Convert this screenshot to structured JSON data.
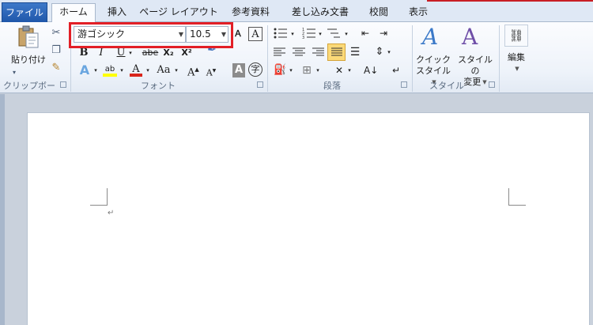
{
  "tabs": {
    "file": "ファイル",
    "home": "ホーム",
    "insert": "挿入",
    "page_layout": "ページ レイアウト",
    "references": "参考資料",
    "mailings": "差し込み文書",
    "review": "校閲",
    "view": "表示"
  },
  "clipboard": {
    "paste_label": "貼り付け",
    "group_label": "クリップボード"
  },
  "font": {
    "font_name": "游ゴシック",
    "font_size": "10.5",
    "group_label": "フォント",
    "bold": "B",
    "italic": "I",
    "underline": "U",
    "strike": "abe",
    "subscript": "X₂",
    "superscript": "X²",
    "grow": "A",
    "shrink": "A",
    "case": "Aa",
    "char_shade": "A",
    "enclose": "字",
    "text_effect": "A",
    "highlight": "ab",
    "font_color": "A"
  },
  "paragraph": {
    "group_label": "段落"
  },
  "styles": {
    "quick_style_line1": "クイック",
    "quick_style_line2": "スタイル",
    "change_style_line1": "スタイルの",
    "change_style_line2": "変更",
    "group_label": "スタイル"
  },
  "editing": {
    "label": "編集"
  },
  "document": {
    "paragraph_mark": "↵"
  },
  "colors": {
    "accent_red": "#e21f26",
    "file_tab": "#2a62b4",
    "highlight_yellow": "#ffff00",
    "font_red": "#d9261c"
  }
}
